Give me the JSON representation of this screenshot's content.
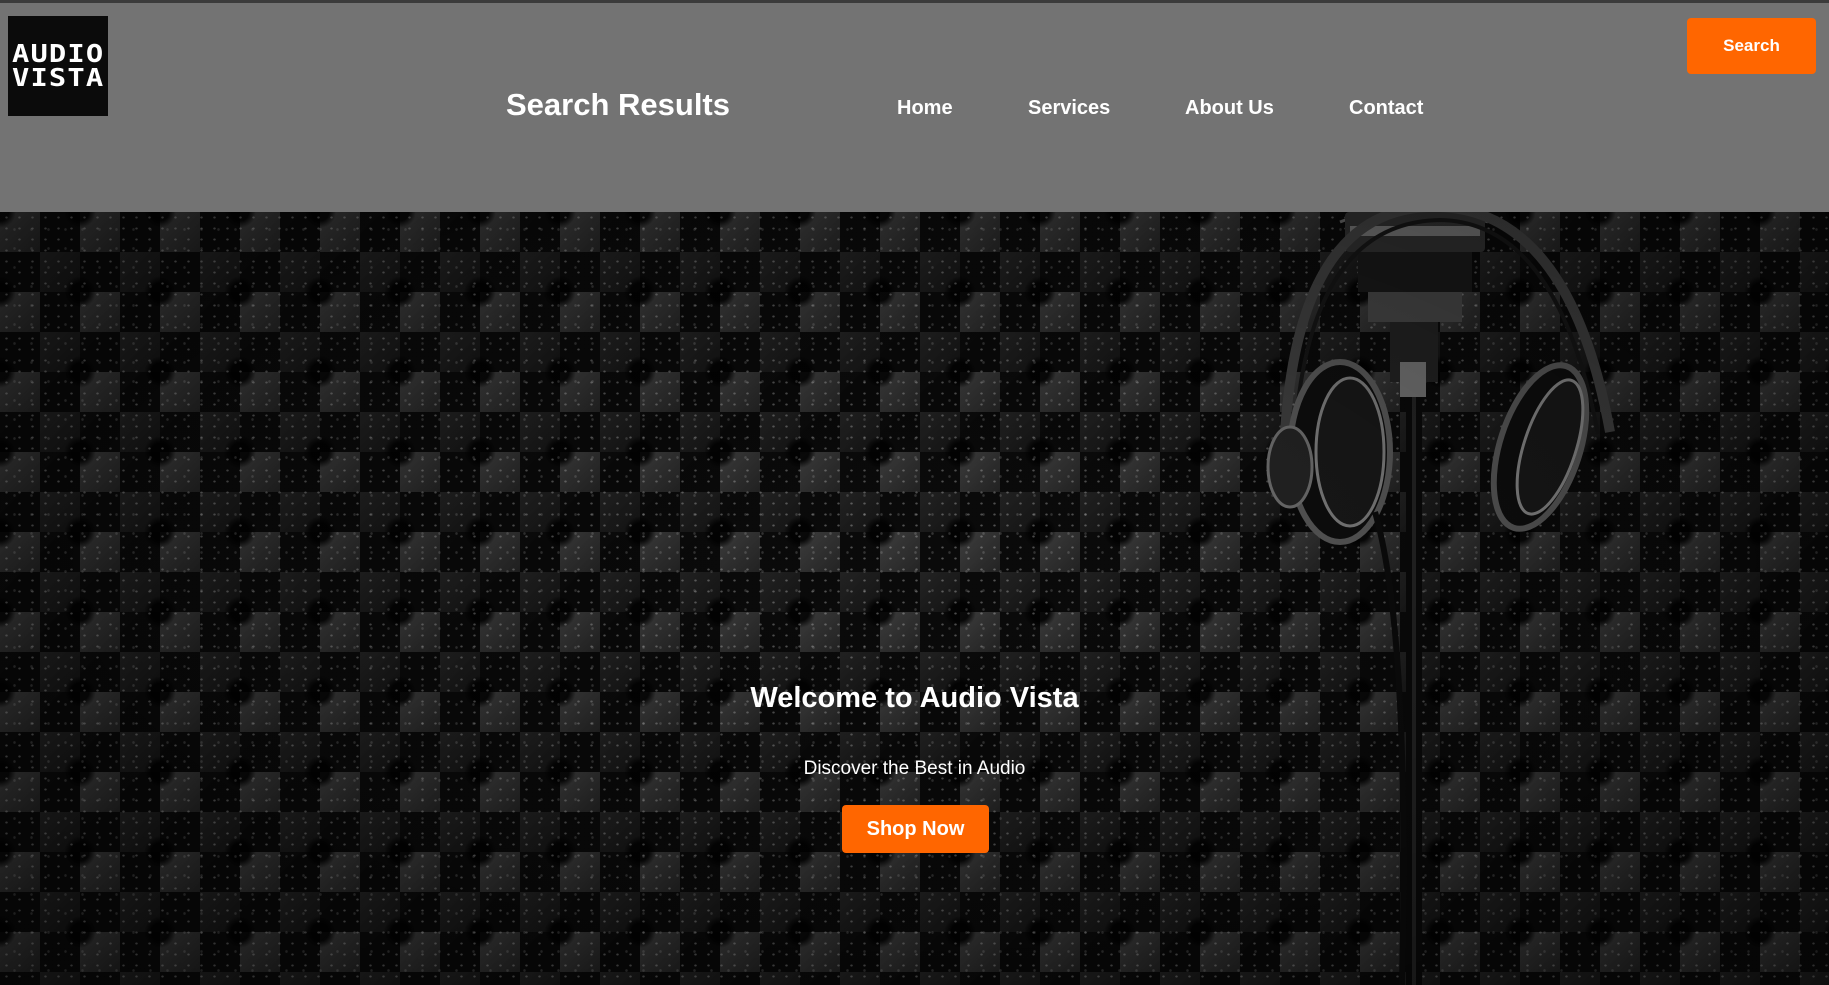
{
  "header": {
    "logo": {
      "line1": "AUDIO",
      "line2": "VISTA",
      "icon": "audio-vista-logo"
    },
    "title": "Search Results",
    "nav": {
      "home": "Home",
      "services": "Services",
      "about": "About Us",
      "contact": "Contact"
    },
    "search_label": "Search"
  },
  "hero": {
    "heading": "Welcome to Audio Vista",
    "subtitle": "Discover the Best in Audio",
    "cta_label": "Shop Now",
    "background": "acoustic-foam-with-studio-microphone-and-headphones"
  },
  "colors": {
    "header_bg": "#737373",
    "accent": "#ff6600",
    "text": "#ffffff",
    "logo_bg": "#0b0b0b"
  }
}
